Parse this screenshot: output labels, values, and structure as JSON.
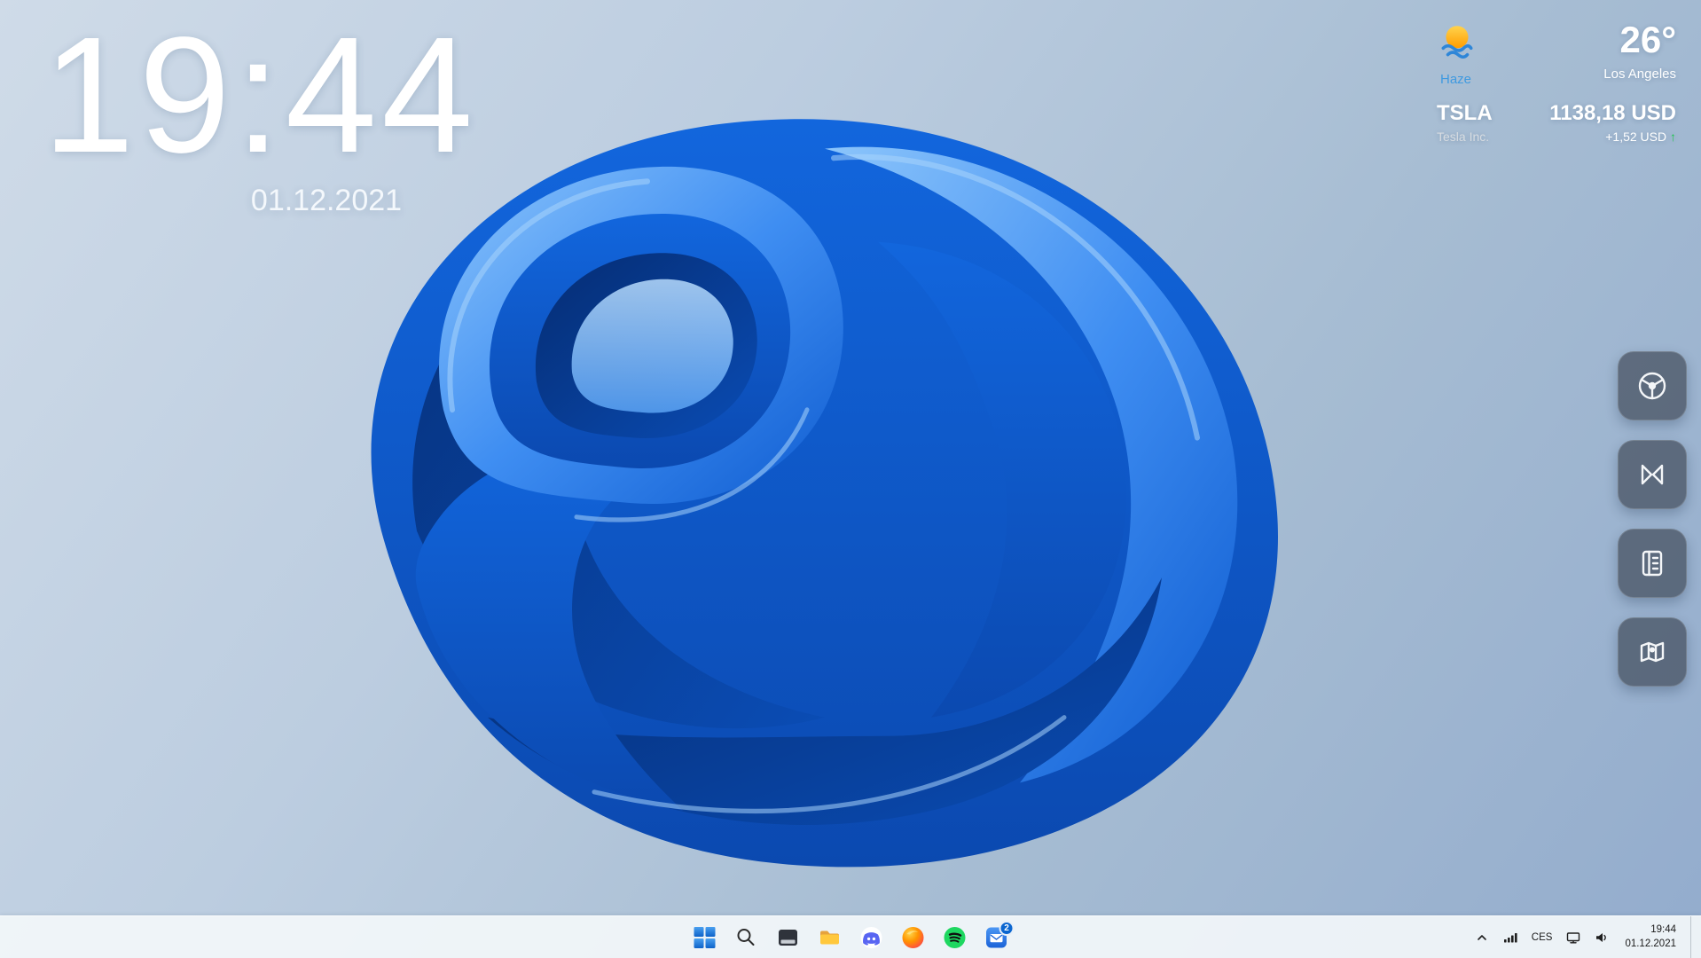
{
  "clock": {
    "time": "19:44",
    "date": "01.12.2021"
  },
  "weather": {
    "icon": "sun-haze-icon",
    "condition": "Haze",
    "temperature": "26°",
    "location": "Los Angeles"
  },
  "stock": {
    "symbol": "TSLA",
    "company": "Tesla Inc.",
    "price": "1138,18 USD",
    "change": "+1,52 USD",
    "arrow": "↑",
    "direction": "up"
  },
  "dock": {
    "items": [
      {
        "icon": "dial-icon"
      },
      {
        "icon": "visual-studio-icon"
      },
      {
        "icon": "notebook-icon"
      },
      {
        "icon": "maps-icon"
      }
    ]
  },
  "taskbar": {
    "apps": [
      {
        "icon": "start-icon"
      },
      {
        "icon": "search-icon"
      },
      {
        "icon": "window-icon"
      },
      {
        "icon": "file-explorer-icon"
      },
      {
        "icon": "discord-icon"
      },
      {
        "icon": "firefox-icon"
      },
      {
        "icon": "spotify-icon"
      },
      {
        "icon": "mail-icon",
        "badge": "2"
      }
    ],
    "tray": {
      "language": "CES",
      "time": "19:44",
      "date": "01.12.2021"
    }
  },
  "colors": {
    "accent_blue": "#0b66d0",
    "haze_blue": "#3f9ae0",
    "stock_up_green": "#23c552",
    "spotify_green": "#1ed760",
    "firefox_orange": "#ff9500",
    "bloom_deep": "#052c72",
    "bloom_light": "#8cc5fb"
  }
}
